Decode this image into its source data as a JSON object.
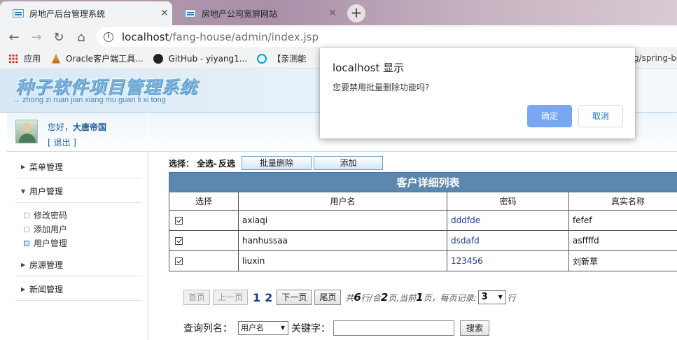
{
  "browser": {
    "tabs": [
      {
        "title": "房地产后台管理系统",
        "close": "✕"
      },
      {
        "title": "房地产公司宽屏网站",
        "close": "✕"
      }
    ],
    "new_tab": "+",
    "nav": {
      "back": "←",
      "forward": "→",
      "reload": "↻",
      "home": "⌂"
    },
    "url_host": "localhost",
    "url_path": "/fang-house/admin/index.jsp",
    "info_glyph": "i",
    "bookmarks": [
      {
        "label": "应用"
      },
      {
        "label": "Oracle客户端工具..."
      },
      {
        "label": "GitHub - yiyang1..."
      },
      {
        "label": "【亲测能"
      }
    ],
    "bookmark_overflow": "g/spring-bo"
  },
  "banner": {
    "title": "种子软件项目管理系统",
    "subtitle": "→ zhong zi ruan jian xiang mu guan li xi tong"
  },
  "user": {
    "greeting_prefix": "您好，",
    "name": "大唐帝国",
    "logout": "[ 退出 ]"
  },
  "sidebar": {
    "groups": [
      {
        "label": "菜单管理",
        "expanded": false
      },
      {
        "label": "用户管理",
        "expanded": true
      },
      {
        "label": "房源管理",
        "expanded": false
      },
      {
        "label": "新闻管理",
        "expanded": false
      }
    ],
    "sub_items": [
      {
        "label": "修改密码"
      },
      {
        "label": "添加用户"
      },
      {
        "label": "用户管理"
      }
    ]
  },
  "toolbar": {
    "select_label": "选择：",
    "select_all": "全选",
    "separator": "-",
    "invert": "反选",
    "batch_delete": "批量删除",
    "add": "添加"
  },
  "table": {
    "caption": "客户详细列表",
    "columns": [
      "选择",
      "用户名",
      "密码",
      "真实名称"
    ],
    "rows": [
      {
        "checked": true,
        "username": "axiaqi",
        "password": "dddfde",
        "realname": "fefef"
      },
      {
        "checked": true,
        "username": "hanhussaa",
        "password": "dsdafd",
        "realname": "asffffd"
      },
      {
        "checked": true,
        "username": "liuxin",
        "password": "123456",
        "realname": "刘新草"
      }
    ]
  },
  "pager": {
    "first": "首页",
    "prev": "上一页",
    "pages": [
      "1",
      "2"
    ],
    "next": "下一页",
    "last": "尾页",
    "total_prefix": "共",
    "total_rows": "6",
    "total_mid": "行/合",
    "total_pages": "2",
    "current_mid": "页,当前",
    "current_page": "1",
    "per_page_label": "页，每页记录:",
    "per_page": "3",
    "row_suffix": "行"
  },
  "search": {
    "column_label": "查询列名：",
    "column_value": "用户名",
    "keyword_label": "关键字：",
    "keyword_value": "",
    "button": "搜索"
  },
  "alert": {
    "title": "localhost 显示",
    "message": "您要禁用批量删除功能吗?",
    "ok": "确定",
    "cancel": "取消"
  },
  "colors": {
    "table_header": "#5c87ae",
    "dialog_ok": "#7aa7f1",
    "link_blue": "#1f5c99"
  }
}
